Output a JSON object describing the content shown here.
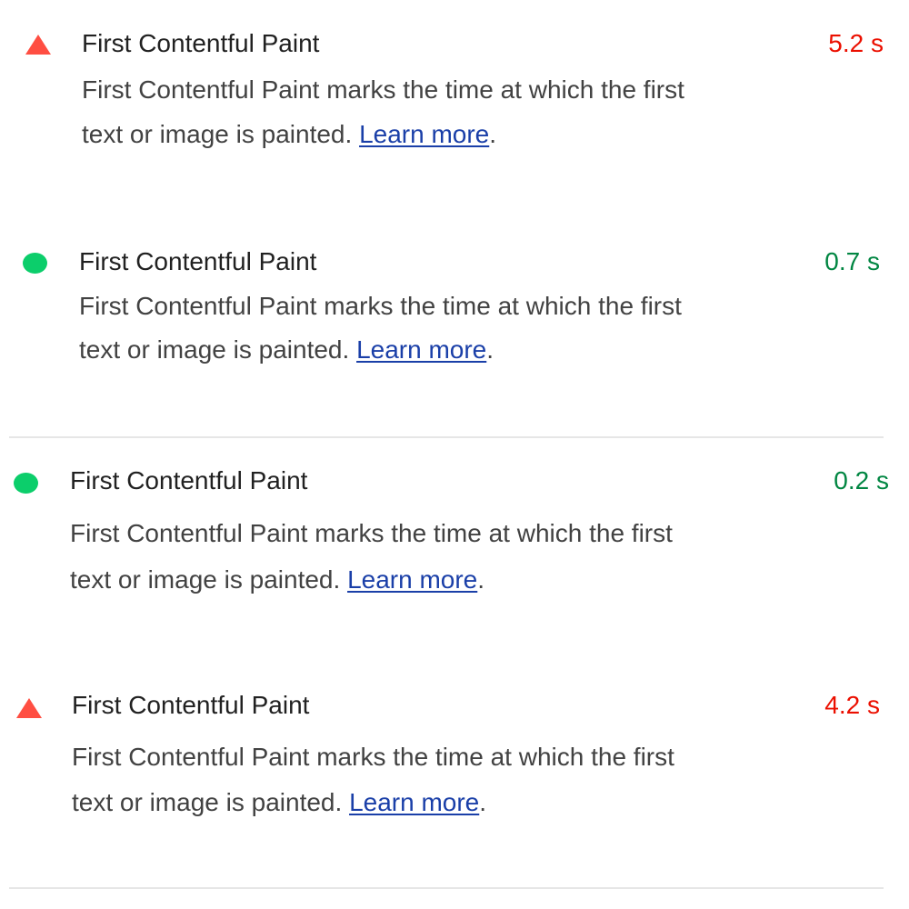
{
  "colors": {
    "fail_icon": "#ff4e42",
    "fail_value": "#eb0f00",
    "pass_icon": "#0cce6b",
    "pass_value": "#018642",
    "link": "#1a3fa8"
  },
  "audits": [
    {
      "status": "fail",
      "icon": "triangle-warning-icon",
      "title": "First Contentful Paint",
      "value": "5.2 s",
      "description": "First Contentful Paint marks the time at which the first text or image is painted.",
      "link_text": "Learn more",
      "trailing": "."
    },
    {
      "status": "pass",
      "icon": "circle-pass-icon",
      "title": "First Contentful Paint",
      "value": "0.7 s",
      "description": "First Contentful Paint marks the time at which the first text or image is painted.",
      "link_text": "Learn more",
      "trailing": "."
    },
    {
      "status": "pass",
      "icon": "circle-pass-icon",
      "title": "First Contentful Paint",
      "value": "0.2 s",
      "description": "First Contentful Paint marks the time at which the first text or image is painted.",
      "link_text": "Learn more",
      "trailing": "."
    },
    {
      "status": "fail",
      "icon": "triangle-warning-icon",
      "title": "First Contentful Paint",
      "value": "4.2 s",
      "description": "First Contentful Paint marks the time at which the first text or image is painted.",
      "link_text": "Learn more",
      "trailing": "."
    }
  ]
}
